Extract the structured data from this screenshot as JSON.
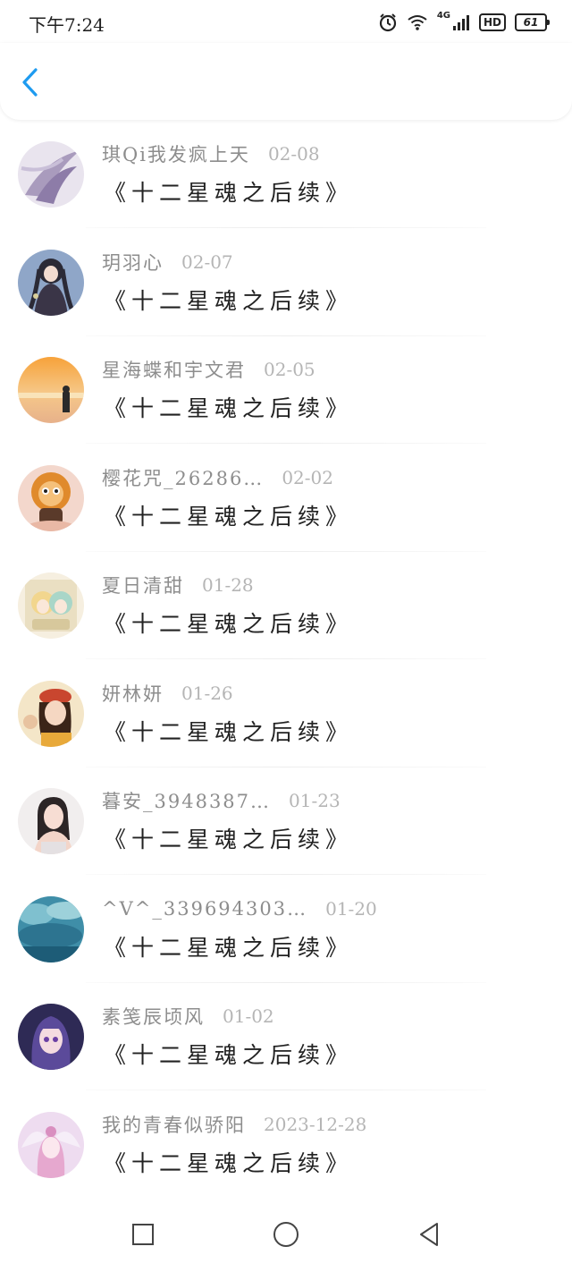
{
  "status_bar": {
    "time": "下午7:24",
    "network": "4G",
    "hd": "HD",
    "battery": "61",
    "icons": [
      "alarm-icon",
      "wifi-icon",
      "signal-icon",
      "battery-icon"
    ]
  },
  "header": {
    "back_icon": "chevron-left-icon",
    "accent_color": "#1e9bf0"
  },
  "comments": [
    {
      "username": "琪Qi我发疯上天",
      "date": "02-08",
      "text": "《十二星魂之后续》",
      "avatar": "purple-feather-avatar"
    },
    {
      "username": "玥羽心",
      "date": "02-07",
      "text": "《十二星魂之后续》",
      "avatar": "anime-girl-dark-avatar"
    },
    {
      "username": "星海蝶和宇文君",
      "date": "02-05",
      "text": "《十二星魂之后续》",
      "avatar": "sunset-beach-avatar"
    },
    {
      "username": "樱花咒_26286…",
      "date": "02-02",
      "text": "《十二星魂之后续》",
      "avatar": "cartoon-lion-avatar"
    },
    {
      "username": "夏日清甜",
      "date": "01-28",
      "text": "《十二星魂之后续》",
      "avatar": "anime-chibi-avatar"
    },
    {
      "username": "妍林妍",
      "date": "01-26",
      "text": "《十二星魂之后续》",
      "avatar": "girl-red-beret-avatar"
    },
    {
      "username": "暮安_3948387…",
      "date": "01-23",
      "text": "《十二星魂之后续》",
      "avatar": "girl-photo-avatar"
    },
    {
      "username": "^V^_339694303…",
      "date": "01-20",
      "text": "《十二星魂之后续》",
      "avatar": "blue-clouds-avatar"
    },
    {
      "username": "素笺辰顷风",
      "date": "01-02",
      "text": "《十二星魂之后续》",
      "avatar": "anime-purple-hair-avatar"
    },
    {
      "username": "我的青春似骄阳",
      "date": "2023-12-28",
      "text": "《十二星魂之后续》",
      "avatar": "pink-angel-avatar"
    }
  ],
  "nav_bar": {
    "recents_icon": "square-icon",
    "home_icon": "circle-icon",
    "back_icon": "triangle-back-icon"
  }
}
